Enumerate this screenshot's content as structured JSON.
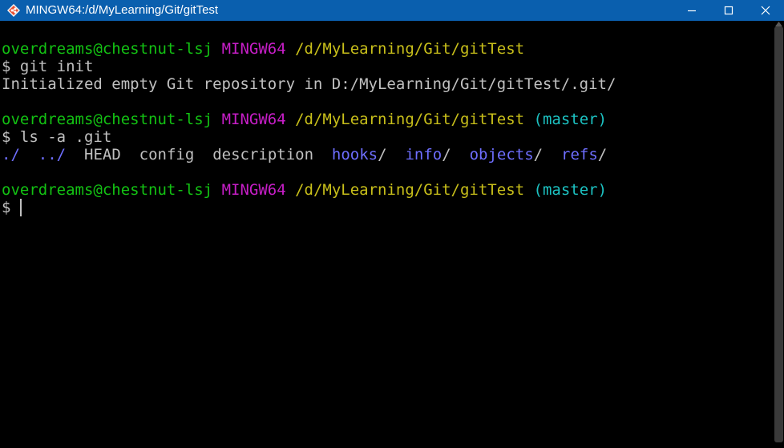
{
  "window": {
    "title": "MINGW64:/d/MyLearning/Git/gitTest",
    "accent": "#0a5fae"
  },
  "icons": {
    "app": "git-bash-diamond-icon",
    "minimize": "minimize-icon",
    "maximize": "maximize-icon",
    "close": "close-icon"
  },
  "colors": {
    "user_host": "#13c213",
    "shell": "#c71ec7",
    "path": "#c8bf1a",
    "branch": "#1cc2c2",
    "text": "#c0c0c0",
    "directory": "#6e6eff"
  },
  "terminal": {
    "prompt1": {
      "user_host": "overdreams@chestnut-lsj",
      "shell": "MINGW64",
      "path": "/d/MyLearning/Git/gitTest"
    },
    "command1": "$ git init",
    "output1": "Initialized empty Git repository in D:/MyLearning/Git/gitTest/.git/",
    "prompt2": {
      "user_host": "overdreams@chestnut-lsj",
      "shell": "MINGW64",
      "path": "/d/MyLearning/Git/gitTest",
      "branch": "(master)"
    },
    "command2": "$ ls -a .git",
    "listing": [
      {
        "name": "./",
        "type": "dir"
      },
      {
        "name": "../",
        "type": "dir"
      },
      {
        "name": "HEAD",
        "type": "file"
      },
      {
        "name": "config",
        "type": "file"
      },
      {
        "name": "description",
        "type": "file"
      },
      {
        "name": "hooks",
        "type": "dir"
      },
      {
        "name": "info",
        "type": "dir"
      },
      {
        "name": "objects",
        "type": "dir"
      },
      {
        "name": "refs",
        "type": "dir"
      }
    ],
    "listing_text": {
      "dot": "./",
      "dotdot": "../",
      "head": "HEAD",
      "config": "config",
      "description": "description",
      "hooks": "hooks",
      "info": "info",
      "objects": "objects",
      "refs": "refs",
      "slash": "/"
    },
    "prompt3": {
      "user_host": "overdreams@chestnut-lsj",
      "shell": "MINGW64",
      "path": "/d/MyLearning/Git/gitTest",
      "branch": "(master)"
    },
    "prompt_symbol": "$"
  }
}
